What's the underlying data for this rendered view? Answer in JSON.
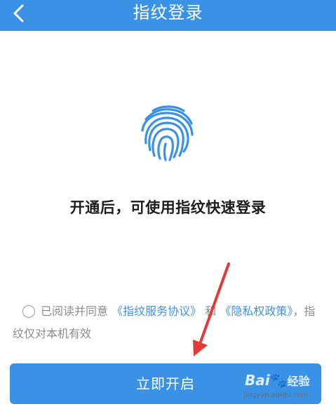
{
  "header": {
    "title": "指纹登录",
    "back_icon": "chevron-left-icon",
    "background": "#3a92e6"
  },
  "main": {
    "fingerprint_icon": "fingerprint-icon",
    "tagline": "开通后，可使用指纹快速登录"
  },
  "agreement": {
    "checked": false,
    "prefix": "已阅读并同意",
    "service_link": "《指纹服务协议》",
    "and_text": "和",
    "privacy_link": "《隐私权政策》",
    "suffix": "，指纹仅对本机有效",
    "link_color": "#3a92e6"
  },
  "action": {
    "enable_label": "立即开启"
  },
  "watermark": {
    "brand": "Bai",
    "brand_suffix": "经验",
    "url": "jingyan.baidu.com"
  },
  "annotation": {
    "arrow_color": "#e53935"
  }
}
